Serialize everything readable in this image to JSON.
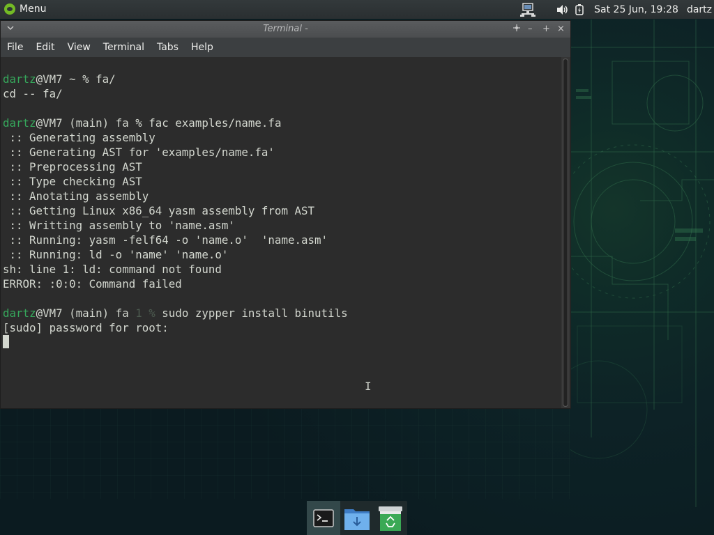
{
  "top_panel": {
    "menu_label": "Menu",
    "clock": "Sat 25 Jun, 19:28",
    "user": "dartz",
    "icons": [
      "network-icon",
      "volume-icon",
      "battery-icon"
    ]
  },
  "window": {
    "title": "Terminal -",
    "controls": [
      "pin",
      "–",
      "+",
      "×"
    ],
    "menu": [
      "File",
      "Edit",
      "View",
      "Terminal",
      "Tabs",
      "Help"
    ]
  },
  "terminal": {
    "prompt_color": "#36a95c",
    "lines": [
      {
        "user": "dartz",
        "rest": "@VM7 ~ % fa/"
      },
      {
        "text": "cd -- fa/"
      },
      {
        "text": ""
      },
      {
        "user": "dartz",
        "rest": "@VM7 (main) fa % fac examples/name.fa"
      },
      {
        "text": " :: Generating assembly"
      },
      {
        "text": " :: Generating AST for 'examples/name.fa'"
      },
      {
        "text": " :: Preprocessing AST"
      },
      {
        "text": " :: Type checking AST"
      },
      {
        "text": " :: Anotating assembly"
      },
      {
        "text": " :: Getting Linux x86_64 yasm assembly from AST"
      },
      {
        "text": " :: Writting assembly to 'name.asm'"
      },
      {
        "text": " :: Running: yasm -felf64 -o 'name.o'  'name.asm'"
      },
      {
        "text": " :: Running: ld -o 'name' 'name.o'"
      },
      {
        "text": "sh: line 1: ld: command not found"
      },
      {
        "text": "ERROR: :0:0: Command failed"
      },
      {
        "text": ""
      },
      {
        "user": "dartz",
        "rest": "@VM7 (main) fa ",
        "dim": "1 %",
        "tail": " sudo zypper install binutils"
      },
      {
        "text": "[sudo] password for root:"
      }
    ]
  },
  "dock": {
    "items": [
      "terminal-icon",
      "files-icon",
      "trash-icon"
    ]
  }
}
